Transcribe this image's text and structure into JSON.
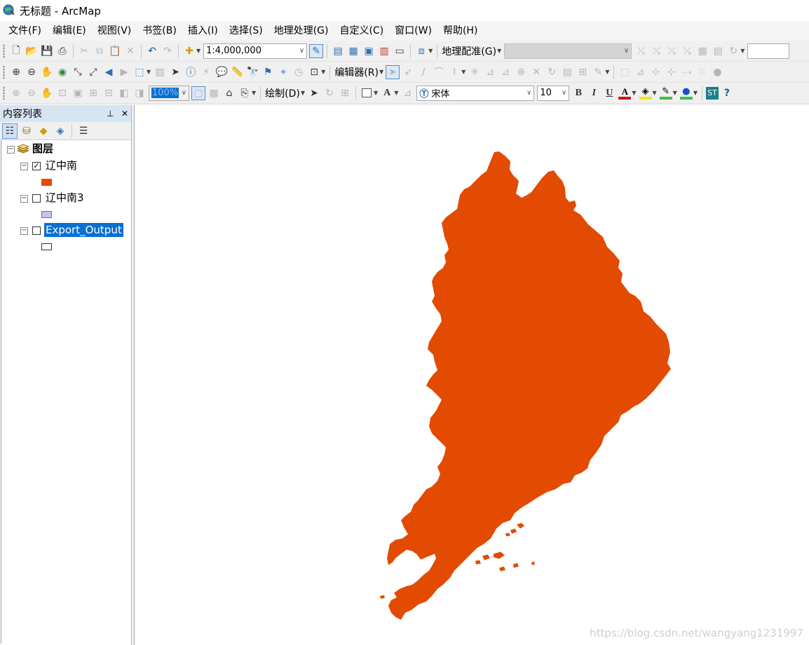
{
  "window": {
    "title": "无标题 - ArcMap",
    "icon": "arcmap-globe-icon"
  },
  "menu": [
    "文件(F)",
    "编辑(E)",
    "视图(V)",
    "书签(B)",
    "插入(I)",
    "选择(S)",
    "地理处理(G)",
    "自定义(C)",
    "窗口(W)",
    "帮助(H)"
  ],
  "toolbar1": {
    "scale": "1:4,000,000",
    "georef_label": "地理配准(G)"
  },
  "toolbar2": {
    "editor_label": "编辑器(R)"
  },
  "toolbar3": {
    "zoom_percent": "100%",
    "draw_label": "绘制(D)",
    "font_name": "宋体",
    "font_size": "10",
    "bold_label": "B",
    "italic_label": "I",
    "underline_label": "U",
    "font_color_glyph": "A",
    "text_tool_glyph": "A",
    "st_label": "ST",
    "help_label": "?"
  },
  "toc": {
    "title": "内容列表",
    "pin_icon": "pin-icon",
    "close_icon": "close-icon",
    "root_label": "图层",
    "layers": [
      {
        "name": "辽中南",
        "checked": true,
        "symbol_color": "#e34a02",
        "symbol_border": "#e34a02"
      },
      {
        "name": "辽中南3",
        "checked": false,
        "symbol_color": "#c4c4f2",
        "symbol_border": "#6a6aa8"
      },
      {
        "name": "Export_Output",
        "checked": false,
        "symbol_color": "#ffffff",
        "symbol_border": "#333333",
        "selected": true
      }
    ]
  },
  "map": {
    "fill_color": "#e34a02"
  },
  "watermark": "https://blog.csdn.net/wangyang1231997",
  "colors": {
    "toc_header": "#d7e4f2",
    "selection": "#0a6fd3",
    "highlight_color_bar": "#f0e81a",
    "line_color_bar": "#3fbf3f",
    "font_color_bar": "#d21414"
  }
}
